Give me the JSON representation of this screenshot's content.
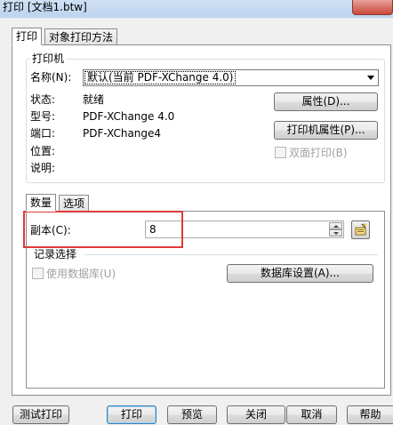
{
  "window": {
    "title": "打印 [文档1.btw]"
  },
  "tabs": [
    {
      "label": "打印",
      "active": true
    },
    {
      "label": "对象打印方法",
      "active": false
    }
  ],
  "printer": {
    "group_title": "打印机",
    "name_label": "名称(N):",
    "name_value": "默认(当前 PDF-XChange 4.0)",
    "status_label": "状态:",
    "status_value": "就绪",
    "model_label": "型号:",
    "model_value": "PDF-XChange 4.0",
    "port_label": "端口:",
    "port_value": "PDF-XChange4",
    "location_label": "位置:",
    "comment_label": "说明:",
    "properties_button": "属性(D)...",
    "printer_properties_button": "打印机属性(P)...",
    "duplex_label": "双面打印(B)"
  },
  "subtabs": [
    {
      "label": "数量",
      "active": true
    },
    {
      "label": "选项",
      "active": false
    }
  ],
  "quantity": {
    "copies_label": "副本(C):",
    "copies_value": "8",
    "records_group_title": "记录选择",
    "use_database_label": "使用数据库(U)",
    "database_settings_button": "数据库设置(A)..."
  },
  "footer": {
    "test_print": "测试打印",
    "print": "打印",
    "preview": "预览",
    "close": "关闭",
    "cancel": "取消",
    "help": "帮助"
  },
  "colors": {
    "highlight": "#e03a3a",
    "default_button_border": "#3c7fb1"
  }
}
